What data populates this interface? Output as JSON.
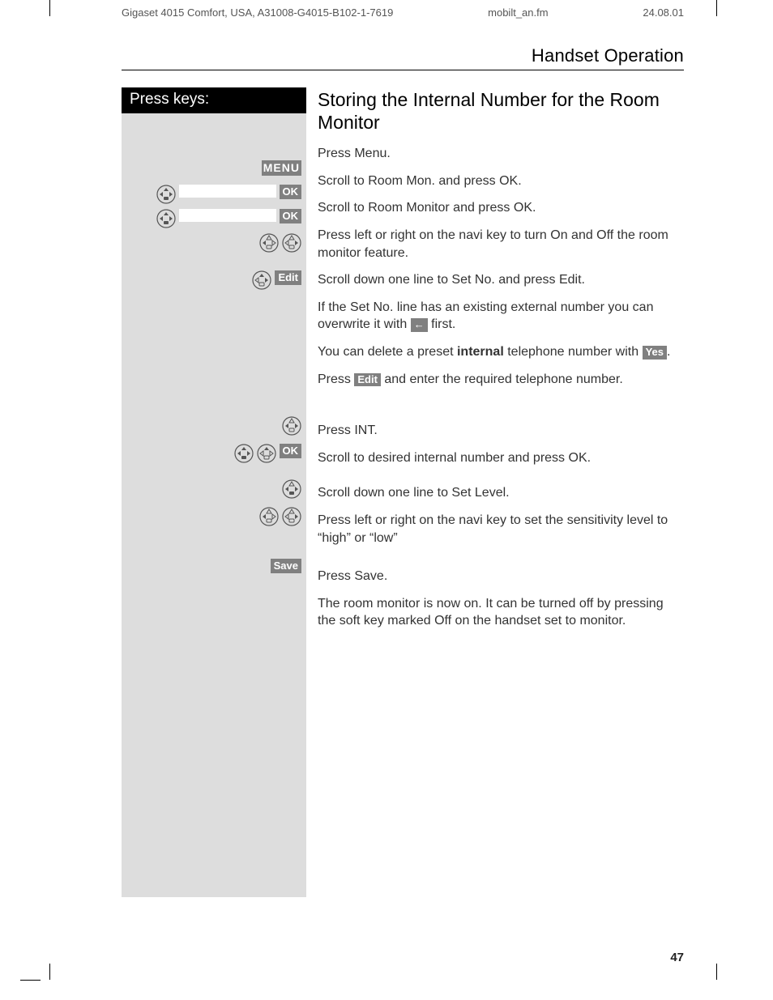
{
  "meta": {
    "product": "Gigaset 4015 Comfort, USA, A31008-G4015-B102-1-7619",
    "filename": "mobilt_an.fm",
    "date": "24.08.01"
  },
  "section_title": "Handset Operation",
  "left_header": "Press keys:",
  "topic_title": "Storing the Internal Number for the Room Monitor",
  "keys": {
    "menu": "MENU",
    "ok": "OK",
    "edit": "Edit",
    "save": "Save",
    "yes": "Yes",
    "back_arrow": "←"
  },
  "steps": {
    "s1": "Press Menu.",
    "s2": "Scroll to Room Mon. and press OK.",
    "s3": "Scroll to Room Monitor and press OK.",
    "s4": "Press left or right on the navi key to turn On and Off the room monitor feature.",
    "s5": "Scroll down one line to Set No. and press Edit.",
    "s6a": "If the Set No. line has an existing external number you can overwrite it with ",
    "s6b": " first.",
    "s7a": "You can delete a preset ",
    "s7b": "internal",
    "s7c": " telephone number with ",
    "s7d": ".",
    "s8a": "Press ",
    "s8b": " and enter the required telephone number.",
    "s9": "Press INT.",
    "s10": "Scroll to desired internal number and press OK.",
    "s11": "Scroll down one line to Set Level.",
    "s12": "Press left or right on the navi key to set the sensitivity level to “high” or “low”",
    "s13": "Press Save.",
    "s14": "The room monitor is now on.  It can be turned off by pressing the soft key marked Off on the handset set to monitor."
  },
  "page_number": "47"
}
